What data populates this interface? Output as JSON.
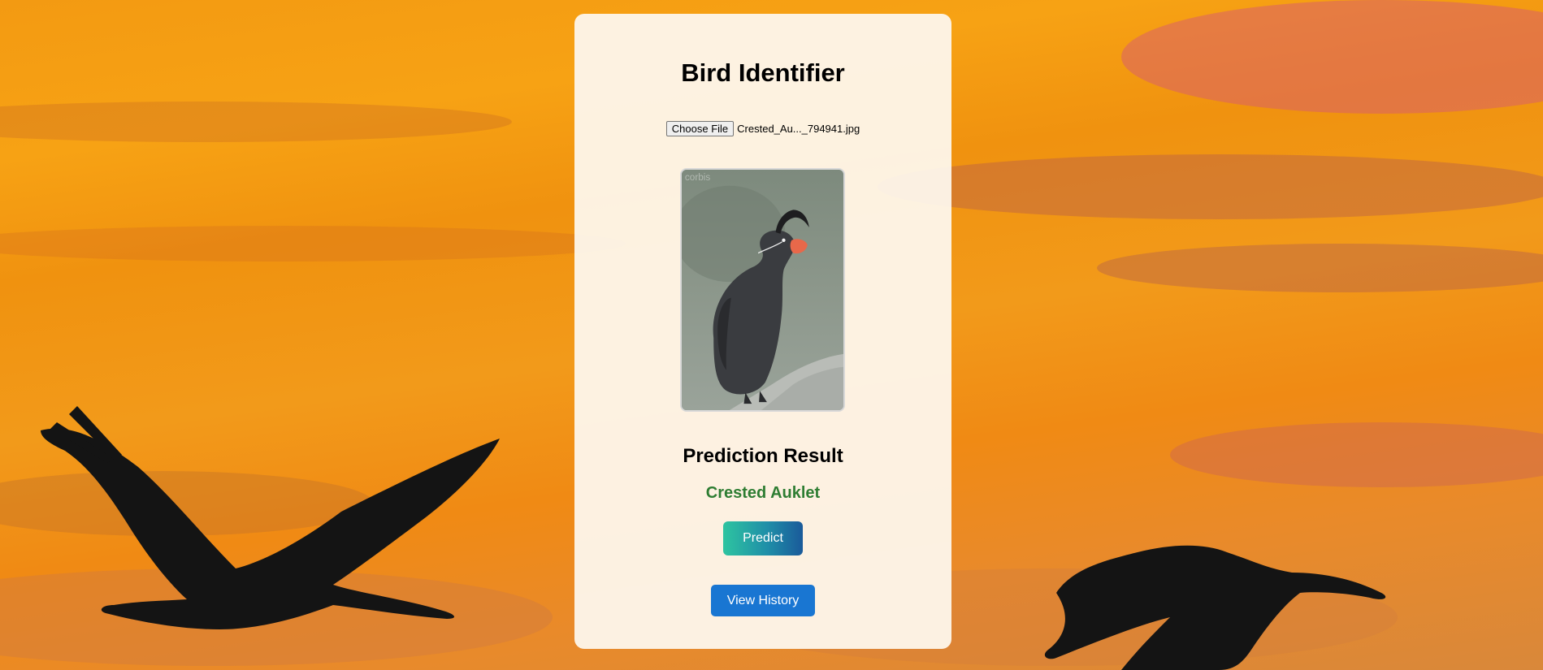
{
  "app": {
    "title": "Bird Identifier"
  },
  "upload": {
    "button_label": "Choose File",
    "file_name": "Crested_Au..._794941.jpg"
  },
  "preview": {
    "watermark": "corbis"
  },
  "result": {
    "heading": "Prediction Result",
    "value": "Crested Auklet",
    "value_color": "#2e7d32"
  },
  "actions": {
    "predict_label": "Predict",
    "history_label": "View History"
  },
  "colors": {
    "history_button": "#1976d2",
    "predict_gradient_start": "#2ec4a0",
    "predict_gradient_end": "#1a5a9a"
  }
}
